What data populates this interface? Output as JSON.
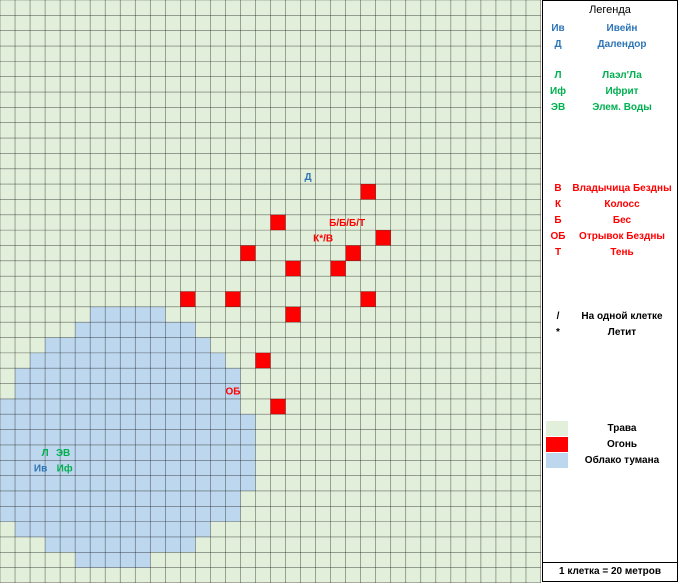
{
  "legend": {
    "title": "Легенда",
    "allies": [
      {
        "abbr": "Ив",
        "name": "Ивейн",
        "color": "#2e75b6"
      },
      {
        "abbr": "Д",
        "name": "Далендор",
        "color": "#2e75b6"
      },
      {
        "abbr": "Л",
        "name": "Лаэл'Ла",
        "color": "#00b050"
      },
      {
        "abbr": "Иф",
        "name": "Ифрит",
        "color": "#00b050"
      },
      {
        "abbr": "ЭВ",
        "name": "Элем. Воды",
        "color": "#00b050"
      }
    ],
    "enemies": [
      {
        "abbr": "В",
        "name": "Владычица Бездны"
      },
      {
        "abbr": "К",
        "name": "Колосс"
      },
      {
        "abbr": "Б",
        "name": "Бес"
      },
      {
        "abbr": "ОБ",
        "name": "Отрывок Бездны"
      },
      {
        "abbr": "Т",
        "name": "Тень"
      }
    ],
    "symbols": [
      {
        "symbol": "/",
        "name": "На одной клетке"
      },
      {
        "symbol": "*",
        "name": "Летит"
      }
    ],
    "terrain": [
      {
        "name": "Трава",
        "color": "#e2efda"
      },
      {
        "name": "Огонь",
        "color": "#ff0000"
      },
      {
        "name": "Облако тумана",
        "color": "#bdd7ee"
      }
    ],
    "scale": "1 клетка = 20 метров"
  },
  "map": {
    "columns": 36,
    "rows": 38,
    "colors": {
      "grass": "#e2efda",
      "fire": "#ff0000",
      "fog": "#bdd7ee",
      "grid": "#000000",
      "ally_blue": "#2e75b6",
      "ally_green": "#00b050",
      "enemy": "#ff0000"
    },
    "fire_cells": [
      [
        24,
        12
      ],
      [
        18,
        14
      ],
      [
        25,
        15
      ],
      [
        16,
        16
      ],
      [
        23,
        16
      ],
      [
        19,
        17
      ],
      [
        22,
        17
      ],
      [
        12,
        19
      ],
      [
        15,
        19
      ],
      [
        24,
        19
      ],
      [
        19,
        20
      ],
      [
        17,
        23
      ],
      [
        18,
        26
      ]
    ],
    "fog_rows": [
      [
        6,
        10
      ],
      [
        5,
        12
      ],
      [
        3,
        13
      ],
      [
        2,
        14
      ],
      [
        1,
        15
      ],
      [
        1,
        15
      ],
      [
        0,
        15
      ],
      [
        0,
        16
      ],
      [
        0,
        16
      ],
      [
        0,
        16
      ],
      [
        0,
        16
      ],
      [
        0,
        16
      ],
      [
        0,
        15
      ],
      [
        0,
        15
      ],
      [
        1,
        13
      ],
      [
        3,
        12
      ],
      [
        5,
        9
      ]
    ],
    "fog_start_row": 20,
    "units": [
      {
        "text": "Д",
        "col": 20,
        "row": 11,
        "color": "#2e75b6"
      },
      {
        "text": "Б/Б/Б/Т",
        "col": 22.6,
        "row": 14,
        "color": "#ff0000"
      },
      {
        "text": "К*/В",
        "col": 21,
        "row": 15,
        "color": "#ff0000"
      },
      {
        "text": "ОБ",
        "col": 15,
        "row": 25,
        "color": "#ff0000"
      },
      {
        "text": "Л",
        "col": 2.5,
        "row": 29,
        "color": "#00b050"
      },
      {
        "text": "ЭВ",
        "col": 3.7,
        "row": 29,
        "color": "#00b050"
      },
      {
        "text": "Ив",
        "col": 2.2,
        "row": 30,
        "color": "#2e75b6"
      },
      {
        "text": "Иф",
        "col": 3.8,
        "row": 30,
        "color": "#00b050"
      }
    ]
  }
}
